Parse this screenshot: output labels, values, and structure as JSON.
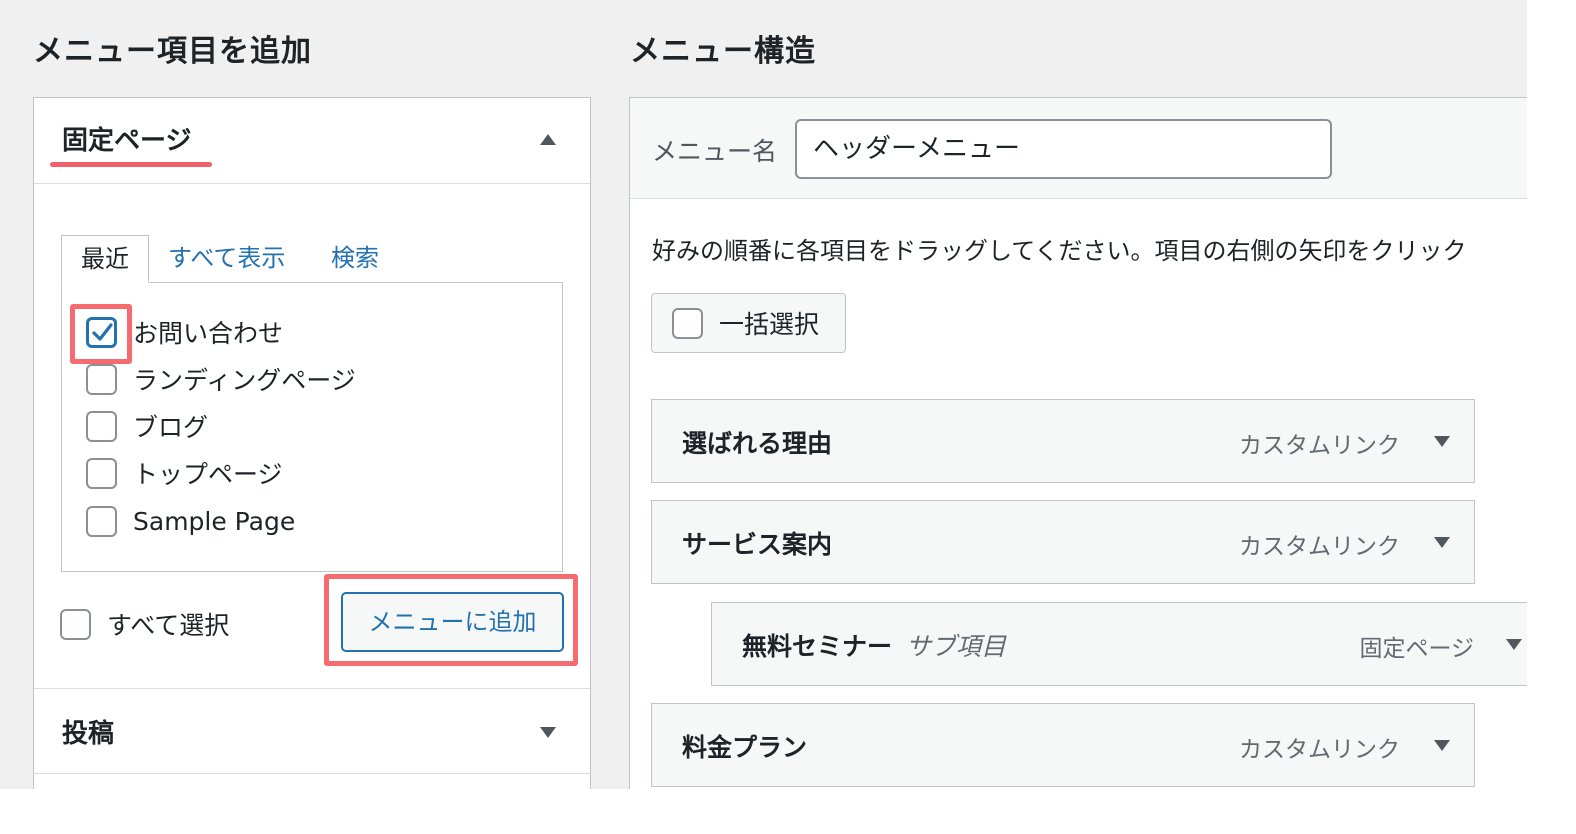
{
  "left": {
    "title": "メニュー項目を追加",
    "pages_section": {
      "title": "固定ページ",
      "tabs": [
        {
          "label": "最近"
        },
        {
          "label": "すべて表示"
        },
        {
          "label": "検索"
        }
      ],
      "items": [
        {
          "label": "お問い合わせ",
          "checked": true
        },
        {
          "label": "ランディングページ",
          "checked": false
        },
        {
          "label": "ブログ",
          "checked": false
        },
        {
          "label": "トップページ",
          "checked": false
        },
        {
          "label": "Sample Page",
          "checked": false
        }
      ],
      "select_all_label": "すべて選択",
      "add_button_label": "メニューに追加"
    },
    "posts_section": {
      "title": "投稿"
    }
  },
  "right": {
    "title": "メニュー構造",
    "menu_name_label": "メニュー名",
    "menu_name_value": "ヘッダーメニュー",
    "instructions": "好みの順番に各項目をドラッグしてください。項目の右側の矢印をクリック",
    "bulk_select_label": "一括選択",
    "menu_items": [
      {
        "title": "選ばれる理由",
        "sub": "",
        "type": "カスタムリンク"
      },
      {
        "title": "サービス案内",
        "sub": "",
        "type": "カスタムリンク"
      },
      {
        "title": "無料セミナー",
        "sub": "サブ項目",
        "type": "固定ページ"
      },
      {
        "title": "料金プラン",
        "sub": "",
        "type": "カスタムリンク"
      }
    ]
  },
  "colors": {
    "accent_blue": "#2271b1",
    "highlight_red": "#f56b70",
    "underline_red": "#f0616b",
    "panel_bg": "#f0f0f1"
  },
  "icons": [
    "checkmark-icon",
    "chevron-up-icon",
    "chevron-down-icon"
  ]
}
